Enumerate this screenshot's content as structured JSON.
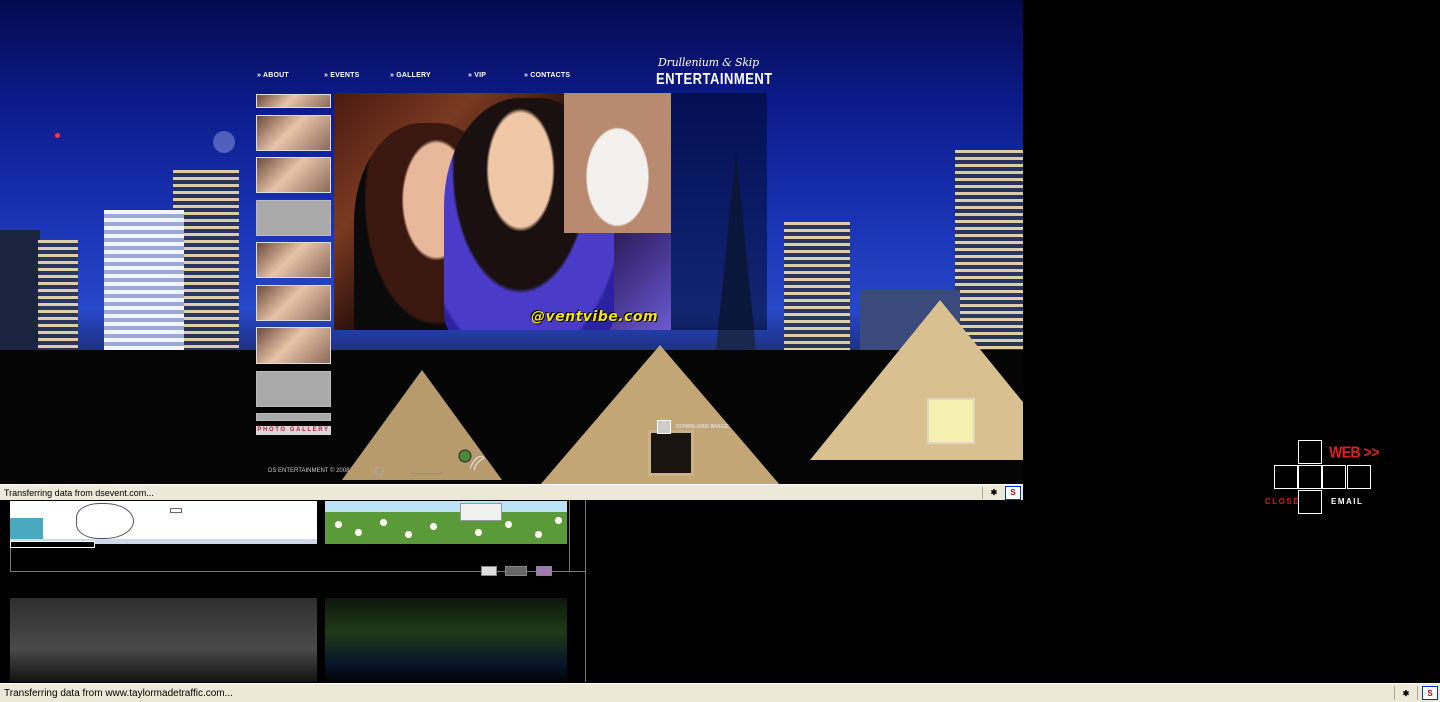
{
  "site": {
    "nav": [
      "» ABOUT",
      "» EVENTS",
      "» GALLERY",
      "» VIP",
      "» CONTACTS"
    ],
    "logo_script": "Drullenium & Skip",
    "logo_main": "ENTERTAINMENT",
    "photo_watermark": "@ventvibe.com",
    "gallery_label": "PHOTO GALLERY",
    "download_label": "DOWNLOAD IMAGE",
    "copyright": "DS ENTERTAINMENT © 2008"
  },
  "status_top": {
    "text": "Transferring data from dsevent.com..."
  },
  "status_bottom": {
    "text": "Transferring data from www.taylormadetraffic.com..."
  },
  "widget": {
    "web": "WEB >>",
    "close": "CLOSE",
    "email": "EMAIL"
  },
  "colors": {
    "accent_red": "#e02020",
    "status_bar": "#ece9d8",
    "watermark_yellow": "#f5e21a"
  }
}
